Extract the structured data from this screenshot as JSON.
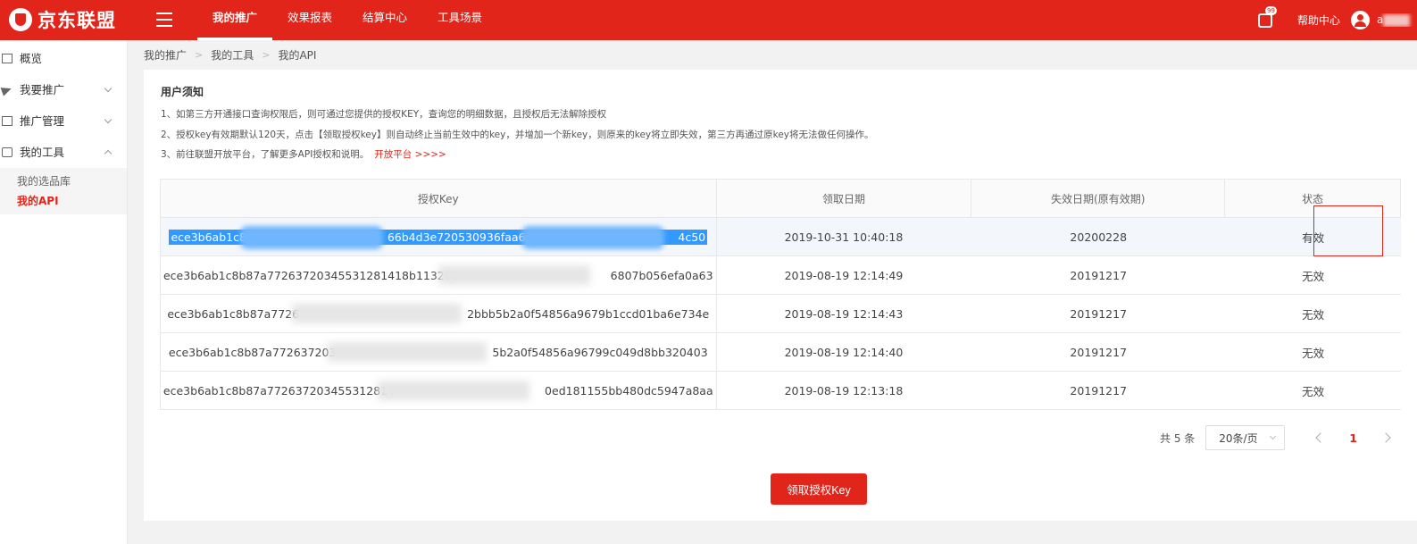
{
  "header": {
    "logo_text": "京东联盟",
    "nav": [
      "我的推广",
      "效果报表",
      "结算中心",
      "工具场景"
    ],
    "active_nav": "我的推广",
    "msg_badge": "99",
    "help": "帮助中心",
    "username": "a"
  },
  "sidebar": {
    "items": [
      {
        "label": "概览",
        "icon": "monitor-icon"
      },
      {
        "label": "我要推广",
        "icon": "send-icon"
      },
      {
        "label": "推广管理",
        "icon": "list-icon"
      },
      {
        "label": "我的工具",
        "icon": "toolbox-icon"
      }
    ],
    "sub_items": [
      "我的选品库",
      "我的API"
    ],
    "active_sub": "我的API"
  },
  "breadcrumb": [
    "我的推广",
    "我的工具",
    "我的API"
  ],
  "notice": {
    "title": "用户须知",
    "line1": "1、如第三方开通接口查询权限后，则可通过您提供的授权KEY，查询您的明细数据，且授权后无法解除授权",
    "line2": "2、授权key有效期默认120天，点击【领取授权key】则自动终止当前生效中的key，并增加一个新key，则原来的key将立即失效，第三方再通过原key将无法做任何操作。",
    "line3": "3、前往联盟开放平台，了解更多API授权和说明。",
    "link": "开放平台 >>>>"
  },
  "table": {
    "headers": [
      "授权Key",
      "领取日期",
      "失效日期(原有效期)",
      "状态"
    ],
    "rows": [
      {
        "key_a": "ece3b6ab1c8b",
        "key_b": "66b4d3e720530936faa653",
        "key_c": "4c50",
        "date": "2019-10-31 10:40:18",
        "expire": "20200228",
        "status": "有效"
      },
      {
        "key_a": "ece3b6ab1c8b87a7726372034553128141​8b113260",
        "key_b": "",
        "key_c": "6807b056efa0a63",
        "date": "2019-08-19 12:14:49",
        "expire": "20191217",
        "status": "无效"
      },
      {
        "key_a": "ece3b6ab1c8b87a7726",
        "key_b": "",
        "key_c": "2bbb5b2a0f54856a9679b1ccd01ba6e734e",
        "date": "2019-08-19 12:14:43",
        "expire": "20191217",
        "status": "无效"
      },
      {
        "key_a": "ece3b6ab1c8b87a772637203",
        "key_b": "",
        "key_c": "5b2a0f54856a96799c049d8bb320403",
        "date": "2019-08-19 12:14:40",
        "expire": "20191217",
        "status": "无效"
      },
      {
        "key_a": "ece3b6ab1c8b87a772637203455312814",
        "key_b": "",
        "key_c": "0ed181155bb480dc5947a8aa",
        "date": "2019-08-19 12:13:18",
        "expire": "20191217",
        "status": "无效"
      }
    ]
  },
  "pagination": {
    "total": "共 5 条",
    "page_size": "20条/页",
    "current": "1"
  },
  "action": {
    "get_key": "领取授权Key"
  },
  "colors": {
    "brand": "#e1251b",
    "selection": "#3399ff"
  }
}
